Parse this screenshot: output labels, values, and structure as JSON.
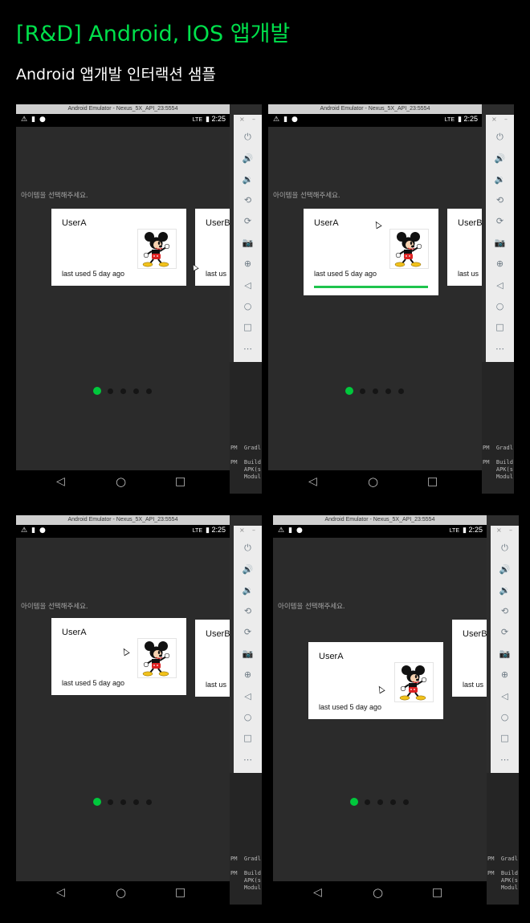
{
  "page": {
    "title": "[R&D] Android, IOS 앱개발",
    "subtitle": "Android 앱개발 인터랙션 샘플"
  },
  "emulator": {
    "window_title": "Android Emulator - Nexus_5X_API_23:5554",
    "status_time": "2:25",
    "status_signal": "LTE",
    "prompt": "아이템을 선택해주세요.",
    "card": {
      "name": "UserA",
      "last_used": "last used 5 day ago",
      "image": "mickey-mouse-image"
    },
    "card_next": {
      "name": "UserB",
      "last_used": "last us"
    },
    "pager": {
      "total": 5,
      "active": 1
    },
    "nav": {
      "back": "◁",
      "home": "○",
      "recent": "□"
    },
    "side_toolbar": {
      "close": "×",
      "minimize": "–",
      "buttons": [
        "power-icon",
        "volume-up-icon",
        "volume-down-icon",
        "rotate-left-icon",
        "rotate-right-icon",
        "camera-icon",
        "zoom-icon",
        "back-icon",
        "home-icon",
        "overview-icon",
        "more-icon"
      ],
      "glyphs": [
        "⏻",
        "🔊",
        "🔉",
        "⟲",
        "⟳",
        "📷",
        "⊕",
        "◁",
        "○",
        "□",
        "⋯"
      ]
    },
    "ide_log": {
      "line1": "PM  Gradl",
      "line2": "PM  Build\n    APK(s\n    Modul"
    }
  },
  "colors": {
    "accent_green": "#00e04b",
    "progress_green": "#1fc44d",
    "dot_active": "#00c83c"
  },
  "frames": [
    {
      "state": "idle",
      "progress": 0
    },
    {
      "state": "pressed",
      "progress": 1
    },
    {
      "state": "idle",
      "progress": 0
    },
    {
      "state": "dragging",
      "progress": 0
    }
  ]
}
